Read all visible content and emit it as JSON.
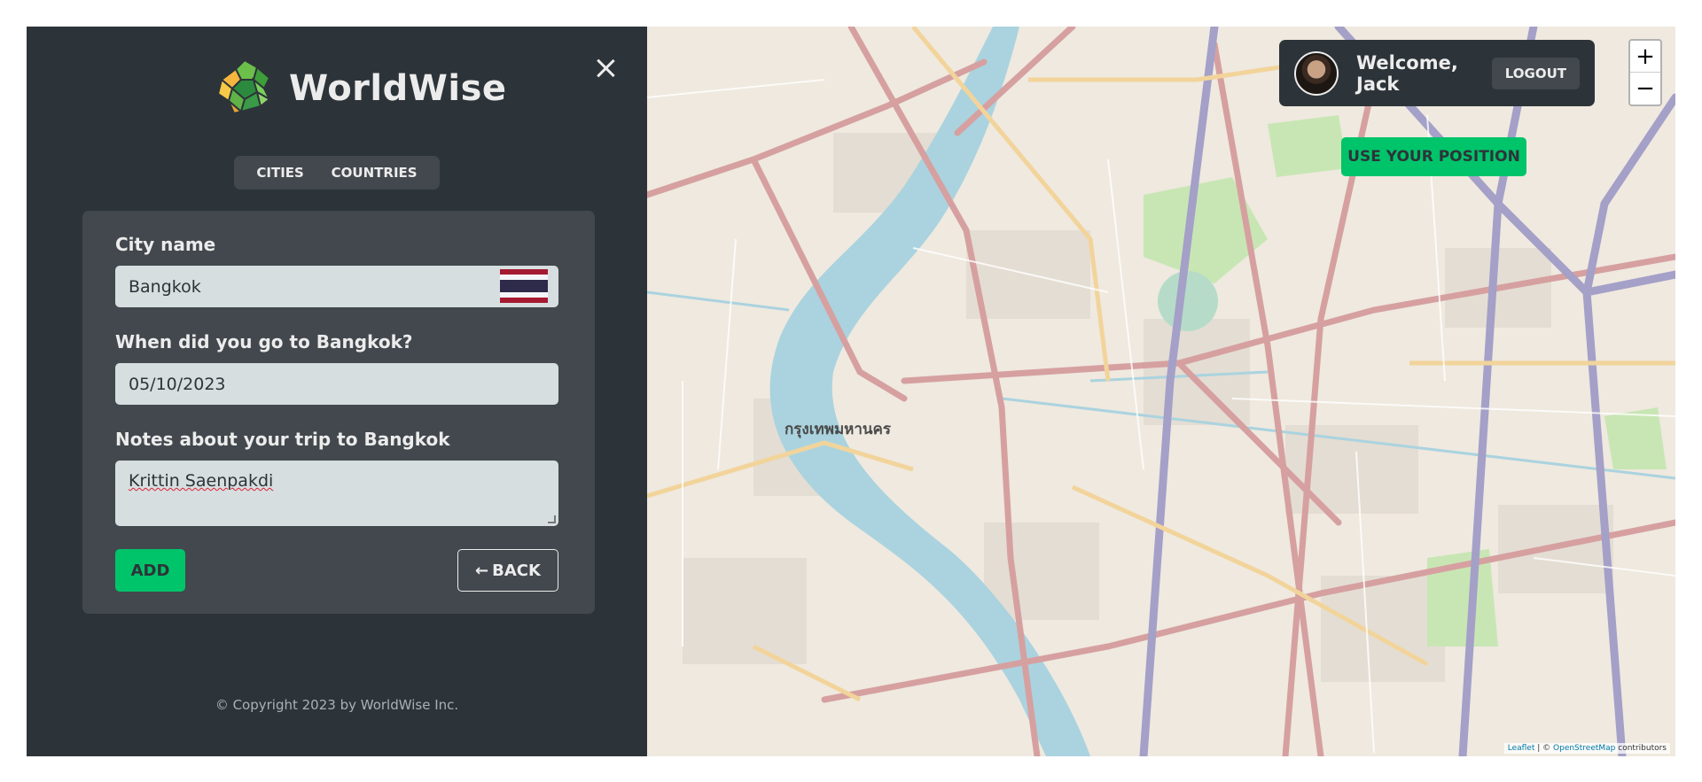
{
  "brand": {
    "name": "WorldWise"
  },
  "tabs": [
    {
      "label": "CITIES"
    },
    {
      "label": "COUNTRIES"
    }
  ],
  "form": {
    "city_label": "City name",
    "city_value": "Bangkok",
    "date_label": "When did you go to Bangkok?",
    "date_value": "05/10/2023",
    "notes_label": "Notes about your trip to Bangkok",
    "notes_value": "Krittin Saenpakdi",
    "add_label": "ADD",
    "back_label": "BACK",
    "back_arrow": "←",
    "flag_colors": [
      "#a51931",
      "#f4f5f8",
      "#2d2a4a",
      "#f4f5f8",
      "#a51931"
    ]
  },
  "footer": {
    "copyright": "© Copyright 2023 by WorldWise Inc."
  },
  "user": {
    "welcome": "Welcome, Jack",
    "logout_label": "LOGOUT"
  },
  "map": {
    "use_position_label": "USE YOUR POSITION",
    "zoom_in": "+",
    "zoom_out": "−",
    "attribution_leaflet": "Leaflet",
    "attribution_sep": " | © ",
    "attribution_osm": "OpenStreetMap",
    "attribution_tail": " contributors",
    "city_label": "กรุงเทพมหานคร"
  },
  "colors": {
    "brand_green": "#00c46a",
    "dark": "#2d3439",
    "panel": "#42484d",
    "river": "#aad3df"
  }
}
